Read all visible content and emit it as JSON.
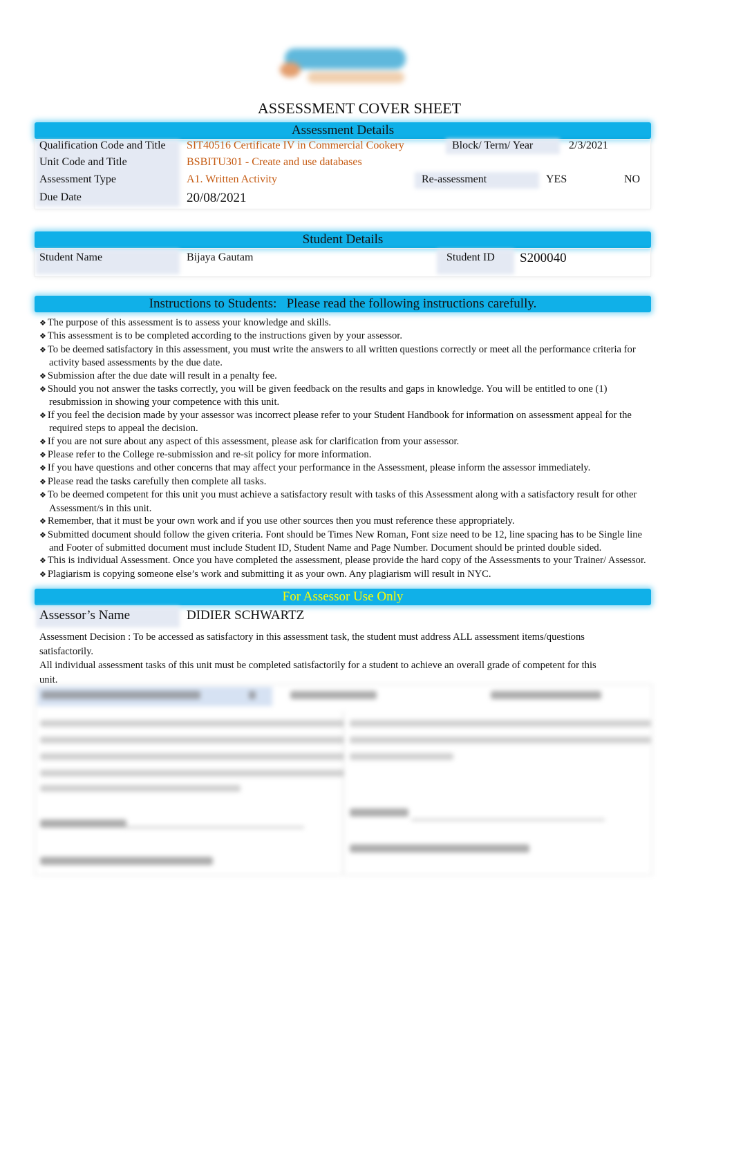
{
  "logo": {
    "text": "Skyline"
  },
  "document_title": "ASSESSMENT COVER SHEET",
  "colors": {
    "header_bar": "#10b0e8",
    "orange_text": "#c55a11",
    "assessor_header_text": "#ffff00"
  },
  "assessment_details": {
    "heading": "Assessment Details",
    "qualification_label": "Qualification Code and Title",
    "qualification_value": "SIT40516 Certificate IV in Commercial Cookery",
    "block_label": "Block/ Term/ Year",
    "block_value": "2/3/2021",
    "unit_label": "Unit Code and Title",
    "unit_value": "BSBITU301 - Create and use databases",
    "type_label": "Assessment Type",
    "type_value": "A1. Written Activity",
    "reassessment_label": "Re-assessment",
    "yes_label": "YES",
    "checkbox_glyph": "",
    "no_label": "NO",
    "due_label": "Due Date",
    "due_value": "20/08/2021"
  },
  "student_details": {
    "heading": "Student Details",
    "name_label": "Student Name",
    "name_value": "Bijaya Gautam",
    "id_label": "Student ID",
    "id_value": "S200040"
  },
  "instructions": {
    "heading": "Instructions to Students:   Please read the following instructions carefully.",
    "items": [
      "The purpose of this assessment is to assess your knowledge and skills.",
      "This assessment is to be completed according to the instructions given by your assessor.",
      "To be deemed satisfactory in this assessment, you must write the answers to all written questions correctly or meet all the performance criteria for activity based assessments by the due date.",
      "Submission after the due date will result in a penalty fee.",
      "Should you not answer the tasks correctly, you will be given feedback on the results and gaps in knowledge. You will be entitled to one (1) resubmission in showing your competence with this unit.",
      "If you feel the decision made by your assessor was incorrect please refer to your Student Handbook for information on assessment appeal for the required steps to appeal the decision.",
      "If you are not sure about any aspect of this assessment, please ask for clarification from your assessor.",
      "Please refer to the College re-submission and re-sit policy for more information.",
      "If you have questions and other concerns that may affect your performance in the Assessment, please inform the assessor immediately.",
      "Please read the tasks carefully then complete all tasks.",
      "To be deemed competent for this unit you must achieve a satisfactory result with tasks of this Assessment along with a satisfactory result for other Assessment/s in this unit.",
      "Remember, that it must be your own work and if you use other sources then you must reference these appropriately.",
      "Submitted document should follow the given criteria. Font should be Times New Roman, Font size need to be 12, line spacing has to be Single line and Footer of submitted document must include Student ID, Student Name and Page Number. Document should be printed double sided.",
      "This is individual Assessment. Once you have completed the assessment, please provide the hard copy of the Assessments to your Trainer/ Assessor.",
      "Plagiarism is copying someone else’s work and submitting it as your own. Any plagiarism will result in NYC."
    ]
  },
  "assessor": {
    "heading": "For Assessor Use Only",
    "name_label": "Assessor’s Name",
    "name_value": "DIDIER SCHWARTZ",
    "decision_text": "Assessment Decision : To be accessed as satisfactory in this assessment task, the student must address ALL assessment items/questions satisfactorily.",
    "overall_text": "All individual assessment tasks of this unit must be completed satisfactorily for a student to achieve an overall grade of competent for this unit."
  }
}
